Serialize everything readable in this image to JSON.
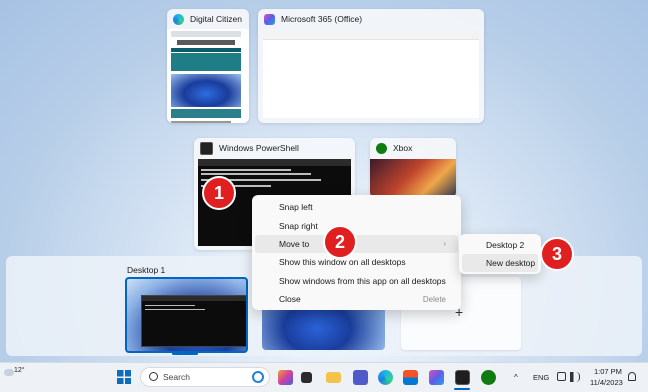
{
  "windows": [
    {
      "title": "Digital Citizen"
    },
    {
      "title": "Microsoft 365 (Office)"
    },
    {
      "title": "Windows PowerShell"
    },
    {
      "title": "Xbox"
    }
  ],
  "context_menu": {
    "items": [
      {
        "label": "Snap left"
      },
      {
        "label": "Snap right"
      },
      {
        "label": "Move to",
        "has_submenu": true
      },
      {
        "label": "Show this window on all desktops"
      },
      {
        "label": "Show windows from this app on all desktops"
      },
      {
        "label": "Close",
        "shortcut": "Delete"
      }
    ],
    "submenu_arrow": "›"
  },
  "submenu": {
    "items": [
      {
        "label": "Desktop 2"
      },
      {
        "label": "New desktop"
      }
    ]
  },
  "callouts": [
    "1",
    "2",
    "3"
  ],
  "desktops": {
    "desktop1_label": "Desktop 1",
    "new_desktop_glyph": "+"
  },
  "taskbar": {
    "weather_temp": "12°",
    "search_placeholder": "Search",
    "language": "ENG",
    "time": "1:07 PM",
    "date": "11/4/2023",
    "chevron": "^"
  },
  "colors": {
    "callout_red": "#e02020",
    "accent_blue": "#0067c0"
  }
}
